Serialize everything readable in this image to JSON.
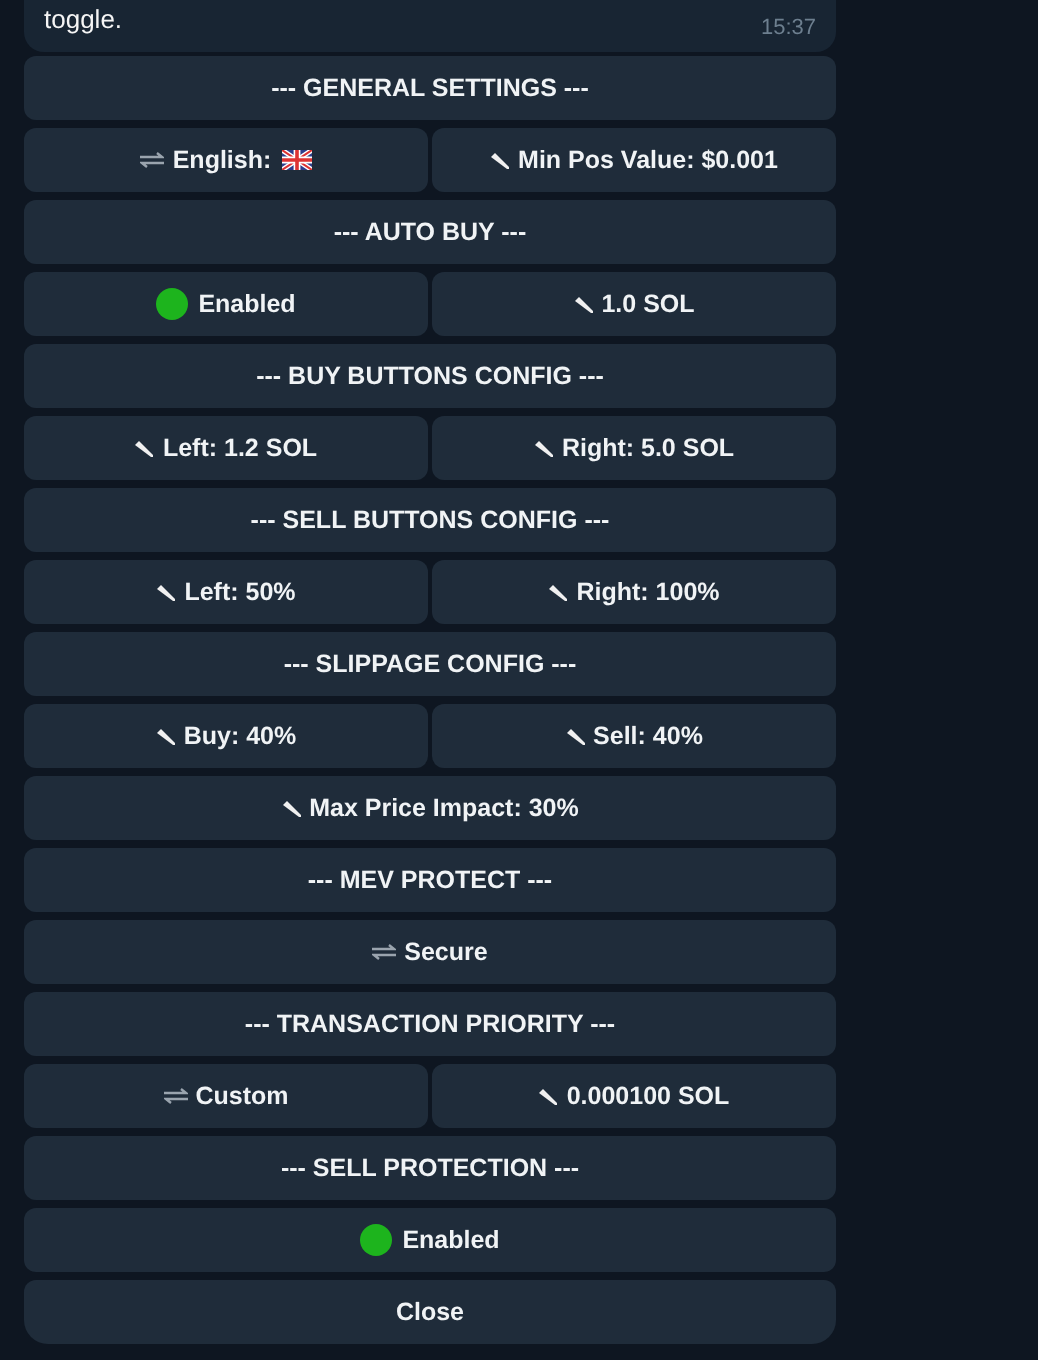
{
  "message": {
    "text": "toggle.",
    "time": "15:37"
  },
  "keyboard": [
    [
      {
        "label": "--- GENERAL SETTINGS ---",
        "kind": "plain"
      }
    ],
    [
      {
        "label": "English:",
        "kind": "language"
      },
      {
        "label": "Min Pos Value: $0.001",
        "kind": "edit"
      }
    ],
    [
      {
        "label": "--- AUTO BUY ---",
        "kind": "plain"
      }
    ],
    [
      {
        "label": "Enabled",
        "kind": "status",
        "color": "#1db41d"
      },
      {
        "label": "1.0 SOL",
        "kind": "edit"
      }
    ],
    [
      {
        "label": "--- BUY BUTTONS CONFIG ---",
        "kind": "plain"
      }
    ],
    [
      {
        "label": "Left: 1.2 SOL",
        "kind": "edit"
      },
      {
        "label": "Right: 5.0 SOL",
        "kind": "edit"
      }
    ],
    [
      {
        "label": "--- SELL BUTTONS CONFIG ---",
        "kind": "plain"
      }
    ],
    [
      {
        "label": "Left: 50%",
        "kind": "edit"
      },
      {
        "label": "Right: 100%",
        "kind": "edit"
      }
    ],
    [
      {
        "label": "--- SLIPPAGE CONFIG ---",
        "kind": "plain"
      }
    ],
    [
      {
        "label": "Buy: 40%",
        "kind": "edit"
      },
      {
        "label": "Sell: 40%",
        "kind": "edit"
      }
    ],
    [
      {
        "label": "Max Price Impact: 30%",
        "kind": "edit"
      }
    ],
    [
      {
        "label": "--- MEV PROTECT ---",
        "kind": "plain"
      }
    ],
    [
      {
        "label": "Secure",
        "kind": "toggle"
      }
    ],
    [
      {
        "label": "--- TRANSACTION PRIORITY ---",
        "kind": "plain"
      }
    ],
    [
      {
        "label": "Custom",
        "kind": "toggle"
      },
      {
        "label": "0.000100 SOL",
        "kind": "edit"
      }
    ],
    [
      {
        "label": "--- SELL PROTECTION ---",
        "kind": "plain"
      }
    ],
    [
      {
        "label": "Enabled",
        "kind": "status",
        "color": "#1db41d"
      }
    ],
    [
      {
        "label": "Close",
        "kind": "plain"
      }
    ]
  ]
}
